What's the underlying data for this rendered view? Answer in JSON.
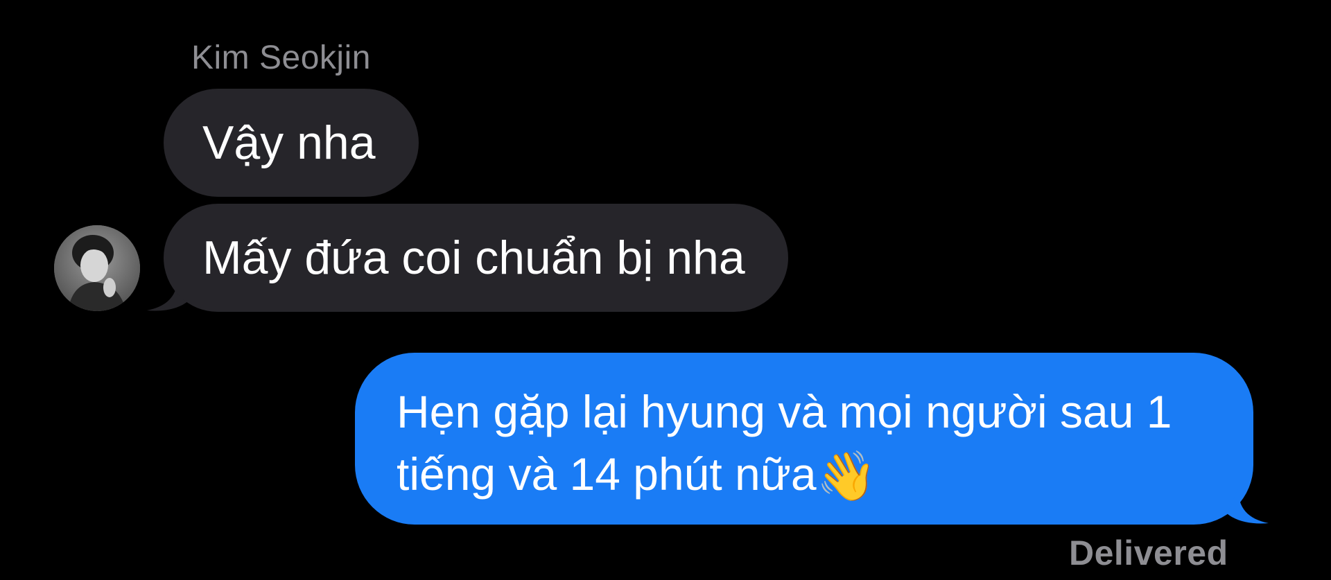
{
  "conversation": {
    "sender_name": "Kim Seokjin",
    "messages": [
      {
        "direction": "incoming",
        "text": "Vậy nha"
      },
      {
        "direction": "incoming",
        "text": "Mấy đứa coi chuẩn bị nha"
      },
      {
        "direction": "outgoing",
        "text": "Hẹn gặp lại hyung và mọi người sau 1 tiếng và 14 phút nữa",
        "emoji": "👋"
      }
    ],
    "status": "Delivered"
  },
  "icons": {
    "avatar": "contact-avatar",
    "wave": "waving-hand-icon"
  },
  "colors": {
    "background": "#000000",
    "incoming_bubble": "#26252a",
    "outgoing_bubble": "#1a7cf5",
    "secondary_text": "#8e8e93"
  }
}
